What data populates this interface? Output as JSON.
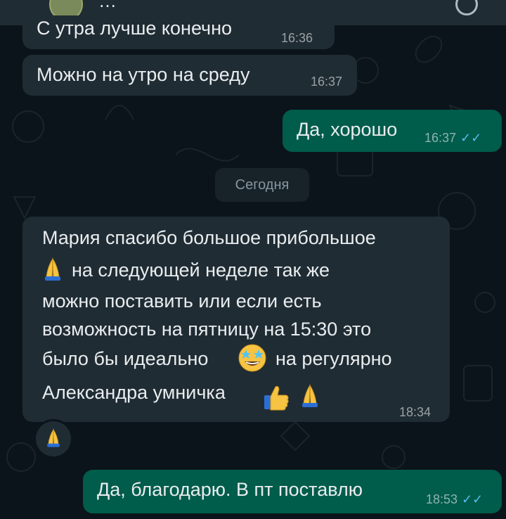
{
  "header": {
    "contact_name": "…"
  },
  "messages": [
    {
      "direction": "in",
      "text": "С утра лучше конечно",
      "time": "16:36"
    },
    {
      "direction": "in",
      "text": "Можно на утро на среду",
      "time": "16:37"
    },
    {
      "direction": "out",
      "text": "Да, хорошо",
      "time": "16:37",
      "status": "read"
    },
    {
      "direction": "in",
      "lines": [
        "Мария спасибо большое прибольшое",
        "на следующей неделе так же",
        "можно поставить или если есть",
        "возможность на пятницу на 15:30  это",
        "было бы идеально",
        "на регулярно",
        "Александра умничка"
      ],
      "time": "18:34",
      "reaction": "folded-hands"
    },
    {
      "direction": "out",
      "text": "Да, благодарю. В пт поставлю",
      "time": "18:53",
      "status": "read"
    }
  ],
  "date_separator": "Сегодня",
  "colors": {
    "background": "#0b141a",
    "incoming_bubble": "#202c33",
    "outgoing_bubble": "#005c4b",
    "read_ticks": "#53bdeb"
  },
  "icons": [
    "double-check-icon",
    "folded-hands-emoji",
    "star-struck-emoji",
    "thumbs-up-emoji"
  ]
}
